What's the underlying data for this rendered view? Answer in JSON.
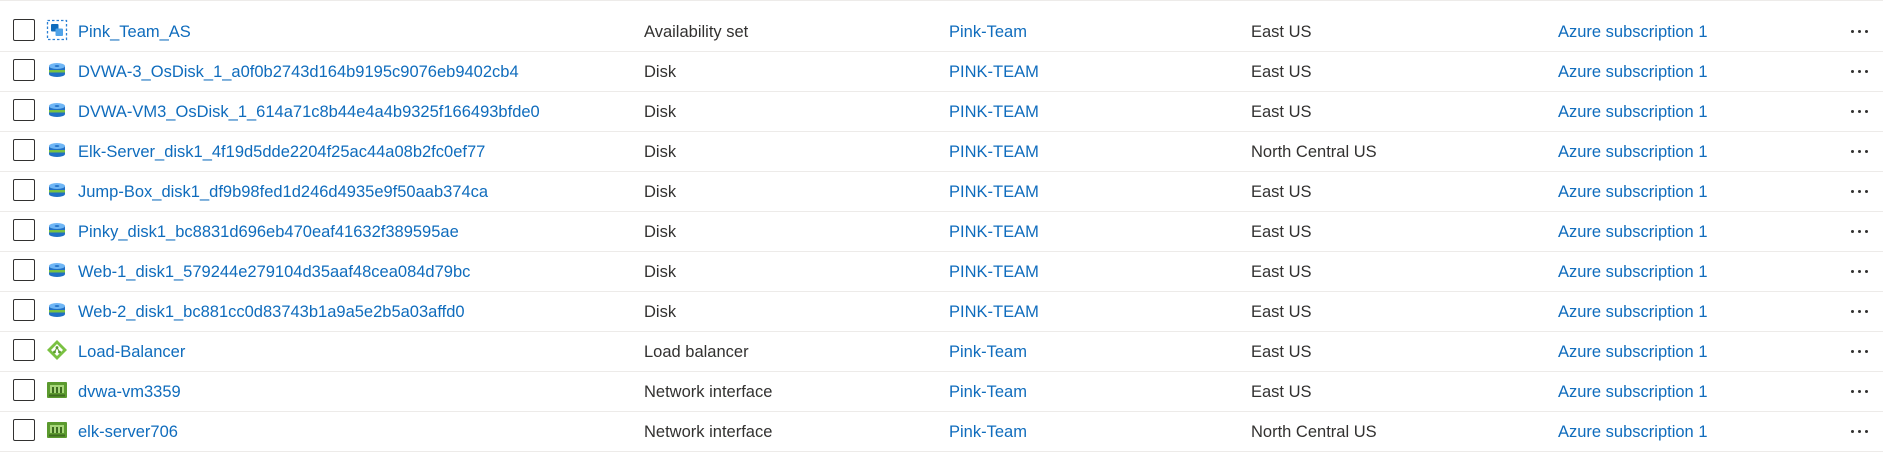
{
  "colors": {
    "link": "#0f6cbd",
    "text": "#323130",
    "divider": "#edebe9"
  },
  "rows": [
    {
      "icon": "availability-set-icon",
      "name": "Pink_Team_AS",
      "type": "Availability set",
      "resource_group": "Pink-Team",
      "location": "East US",
      "subscription": "Azure subscription 1"
    },
    {
      "icon": "disk-icon",
      "name": "DVWA-3_OsDisk_1_a0f0b2743d164b9195c9076eb9402cb4",
      "type": "Disk",
      "resource_group": "PINK-TEAM",
      "location": "East US",
      "subscription": "Azure subscription 1"
    },
    {
      "icon": "disk-icon",
      "name": "DVWA-VM3_OsDisk_1_614a71c8b44e4a4b9325f166493bfde0",
      "type": "Disk",
      "resource_group": "PINK-TEAM",
      "location": "East US",
      "subscription": "Azure subscription 1"
    },
    {
      "icon": "disk-icon",
      "name": "Elk-Server_disk1_4f19d5dde2204f25ac44a08b2fc0ef77",
      "type": "Disk",
      "resource_group": "PINK-TEAM",
      "location": "North Central US",
      "subscription": "Azure subscription 1"
    },
    {
      "icon": "disk-icon",
      "name": "Jump-Box_disk1_df9b98fed1d246d4935e9f50aab374ca",
      "type": "Disk",
      "resource_group": "PINK-TEAM",
      "location": "East US",
      "subscription": "Azure subscription 1"
    },
    {
      "icon": "disk-icon",
      "name": "Pinky_disk1_bc8831d696eb470eaf41632f389595ae",
      "type": "Disk",
      "resource_group": "PINK-TEAM",
      "location": "East US",
      "subscription": "Azure subscription 1"
    },
    {
      "icon": "disk-icon",
      "name": "Web-1_disk1_579244e279104d35aaf48cea084d79bc",
      "type": "Disk",
      "resource_group": "PINK-TEAM",
      "location": "East US",
      "subscription": "Azure subscription 1"
    },
    {
      "icon": "disk-icon",
      "name": "Web-2_disk1_bc881cc0d83743b1a9a5e2b5a03affd0",
      "type": "Disk",
      "resource_group": "PINK-TEAM",
      "location": "East US",
      "subscription": "Azure subscription 1"
    },
    {
      "icon": "load-balancer-icon",
      "name": "Load-Balancer",
      "type": "Load balancer",
      "resource_group": "Pink-Team",
      "location": "East US",
      "subscription": "Azure subscription 1"
    },
    {
      "icon": "network-interface-icon",
      "name": "dvwa-vm3359",
      "type": "Network interface",
      "resource_group": "Pink-Team",
      "location": "East US",
      "subscription": "Azure subscription 1"
    },
    {
      "icon": "network-interface-icon",
      "name": "elk-server706",
      "type": "Network interface",
      "resource_group": "Pink-Team",
      "location": "North Central US",
      "subscription": "Azure subscription 1"
    }
  ]
}
